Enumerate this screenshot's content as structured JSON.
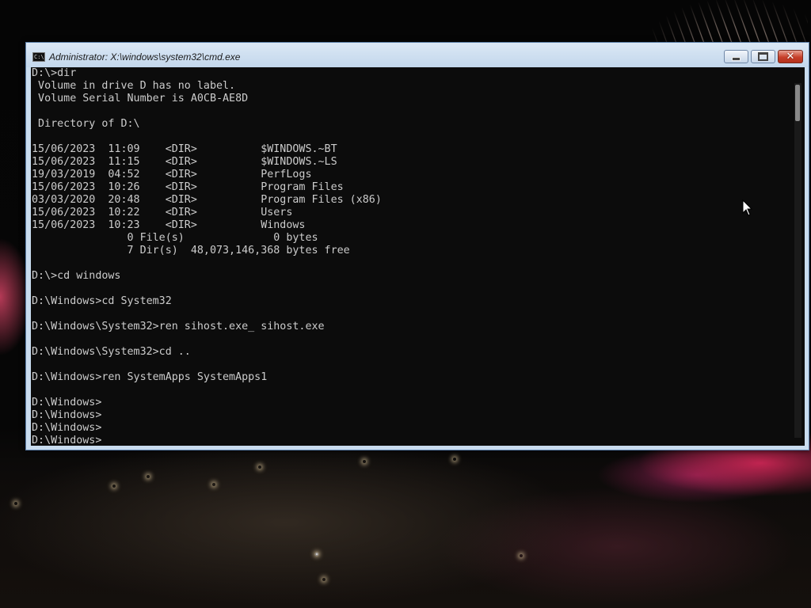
{
  "window": {
    "title": "Administrator: X:\\windows\\system32\\cmd.exe",
    "icon": "cmd-icon",
    "icon_text": "C:\\",
    "buttons": {
      "minimize": "minimize-icon",
      "maximize": "maximize-icon",
      "close": "✕"
    }
  },
  "console": {
    "lines": [
      "D:\\>dir",
      " Volume in drive D has no label.",
      " Volume Serial Number is A0CB-AE8D",
      "",
      " Directory of D:\\",
      "",
      "15/06/2023  11:09    <DIR>          $WINDOWS.~BT",
      "15/06/2023  11:15    <DIR>          $WINDOWS.~LS",
      "19/03/2019  04:52    <DIR>          PerfLogs",
      "15/06/2023  10:26    <DIR>          Program Files",
      "03/03/2020  20:48    <DIR>          Program Files (x86)",
      "15/06/2023  10:22    <DIR>          Users",
      "15/06/2023  10:23    <DIR>          Windows",
      "               0 File(s)              0 bytes",
      "               7 Dir(s)  48,073,146,368 bytes free",
      "",
      "D:\\>cd windows",
      "",
      "D:\\Windows>cd System32",
      "",
      "D:\\Windows\\System32>ren sihost.exe_ sihost.exe",
      "",
      "D:\\Windows\\System32>cd ..",
      "",
      "D:\\Windows>ren SystemApps SystemApps1",
      "",
      "D:\\Windows>",
      "D:\\Windows>",
      "D:\\Windows>",
      "D:\\Windows>"
    ]
  },
  "colors": {
    "console_bg": "#0c0c0c",
    "console_fg": "#cccccc",
    "close_button": "#c7402a",
    "titlebar": "#c9dcef"
  }
}
